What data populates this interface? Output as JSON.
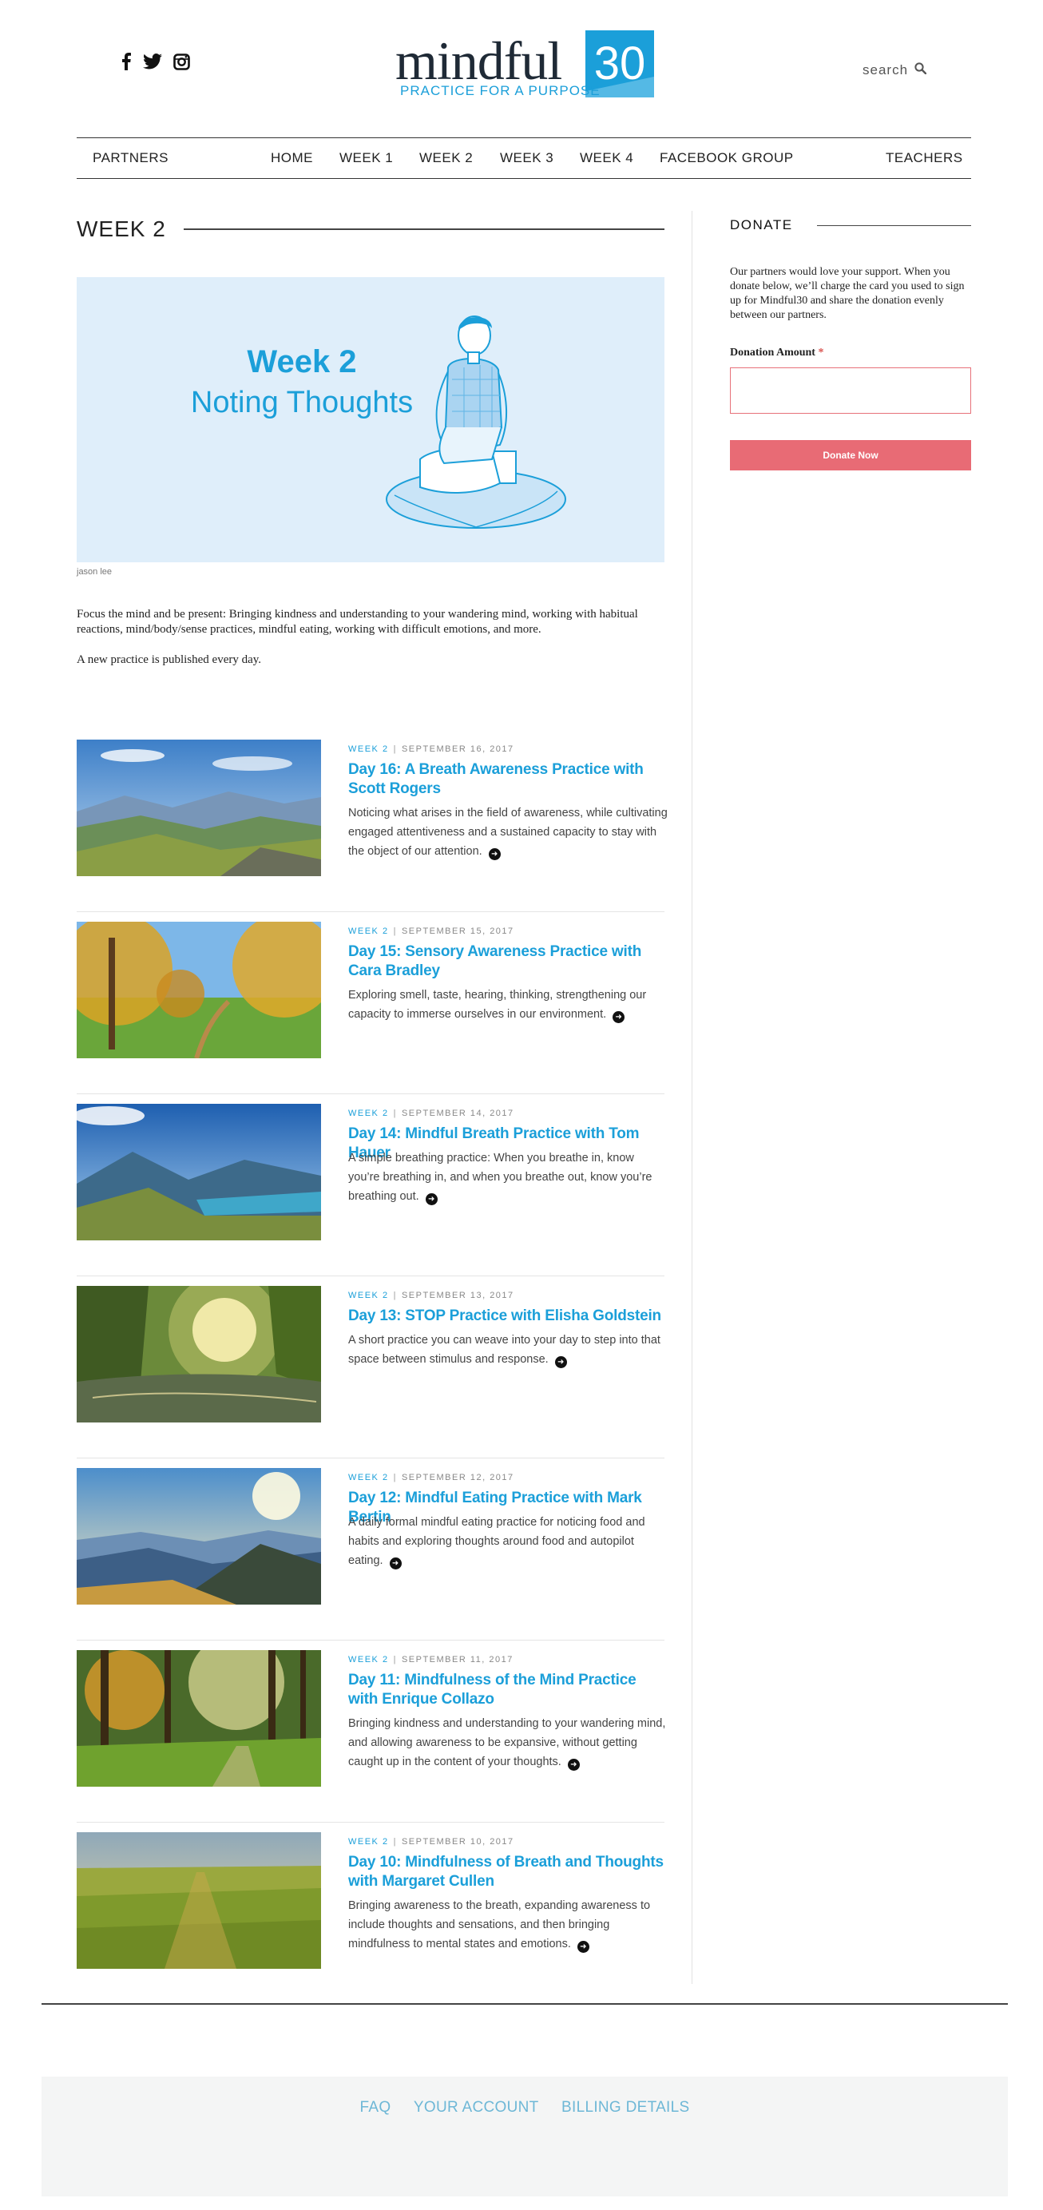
{
  "header": {
    "logo_word": "mindful",
    "logo_number": "30",
    "logo_tagline": "PRACTICE FOR A PURPOSE",
    "search_label": "search",
    "social_icons": [
      "facebook-icon",
      "twitter-icon",
      "instagram-icon"
    ]
  },
  "nav": {
    "items": [
      "PARTNERS",
      "HOME",
      "WEEK 1",
      "WEEK 2",
      "WEEK 3",
      "WEEK 4",
      "FACEBOOK GROUP",
      "TEACHERS"
    ]
  },
  "main": {
    "heading": "WEEK 2",
    "hero": {
      "title_line1": "Week 2",
      "title_line2": "Noting Thoughts",
      "credit": "jason lee"
    },
    "intro": [
      "Focus the mind and be present: Bringing kindness and understanding to your wandering mind, working with habitual reactions, mind/body/sense practices, mindful eating, working with difficult emotions, and more.",
      "A new practice is published every day."
    ],
    "posts": [
      {
        "category": "WEEK 2",
        "date": "SEPTEMBER 16, 2017",
        "title": "Day 16: A Breath Awareness Practice with Scott Rogers",
        "excerpt": "Noticing what arises in the field of awareness, while cultivating engaged attentiveness and a sustained capacity to stay with the object of our attention."
      },
      {
        "category": "WEEK 2",
        "date": "SEPTEMBER 15, 2017",
        "title": "Day 15: Sensory Awareness Practice with Cara Bradley",
        "excerpt": "Exploring smell, taste, hearing, thinking, strengthening our capacity to immerse ourselves in our environment."
      },
      {
        "category": "WEEK 2",
        "date": "SEPTEMBER 14, 2017",
        "title": "Day 14: Mindful Breath Practice with Tom Hauer",
        "excerpt": "A simple breathing practice: When you breathe in, know you’re breathing in, and when you breathe out, know you’re breathing out."
      },
      {
        "category": "WEEK 2",
        "date": "SEPTEMBER 13, 2017",
        "title": "Day 13: STOP Practice with Elisha Goldstein",
        "excerpt": "A short practice you can weave into your day to step into that space between stimulus and response."
      },
      {
        "category": "WEEK 2",
        "date": "SEPTEMBER 12, 2017",
        "title": "Day 12: Mindful Eating Practice with Mark Bertin",
        "excerpt": "A daily formal mindful eating practice for noticing food and habits and exploring thoughts around food and autopilot eating."
      },
      {
        "category": "WEEK 2",
        "date": "SEPTEMBER 11, 2017",
        "title": "Day 11: Mindfulness of the Mind Practice with Enrique Collazo",
        "excerpt": "Bringing kindness and understanding to your wandering mind, and allowing awareness to be expansive, without getting caught up in the content of your thoughts."
      },
      {
        "category": "WEEK 2",
        "date": "SEPTEMBER 10, 2017",
        "title": "Day 10: Mindfulness of Breath and Thoughts with Margaret Cullen",
        "excerpt": "Bringing awareness to the breath, expanding awareness to include thoughts and sensations, and then bringing mindfulness to mental states and emotions."
      }
    ]
  },
  "sidebar": {
    "heading": "DONATE",
    "blurb": "Our partners would love your support. When you donate below, we’ll charge the card you used to sign up for Mindful30 and share the donation evenly between our partners.",
    "amount_label": "Donation Amount",
    "required_mark": "*",
    "amount_value": "",
    "button_label": "Donate Now"
  },
  "footer": {
    "links": [
      "FAQ",
      "YOUR ACCOUNT",
      "BILLING DETAILS"
    ]
  },
  "colors": {
    "accent_blue": "#1b9fd9",
    "donate_button": "#e86b75",
    "hero_background": "#dfeefa",
    "footer_background": "#f4f5f5"
  }
}
